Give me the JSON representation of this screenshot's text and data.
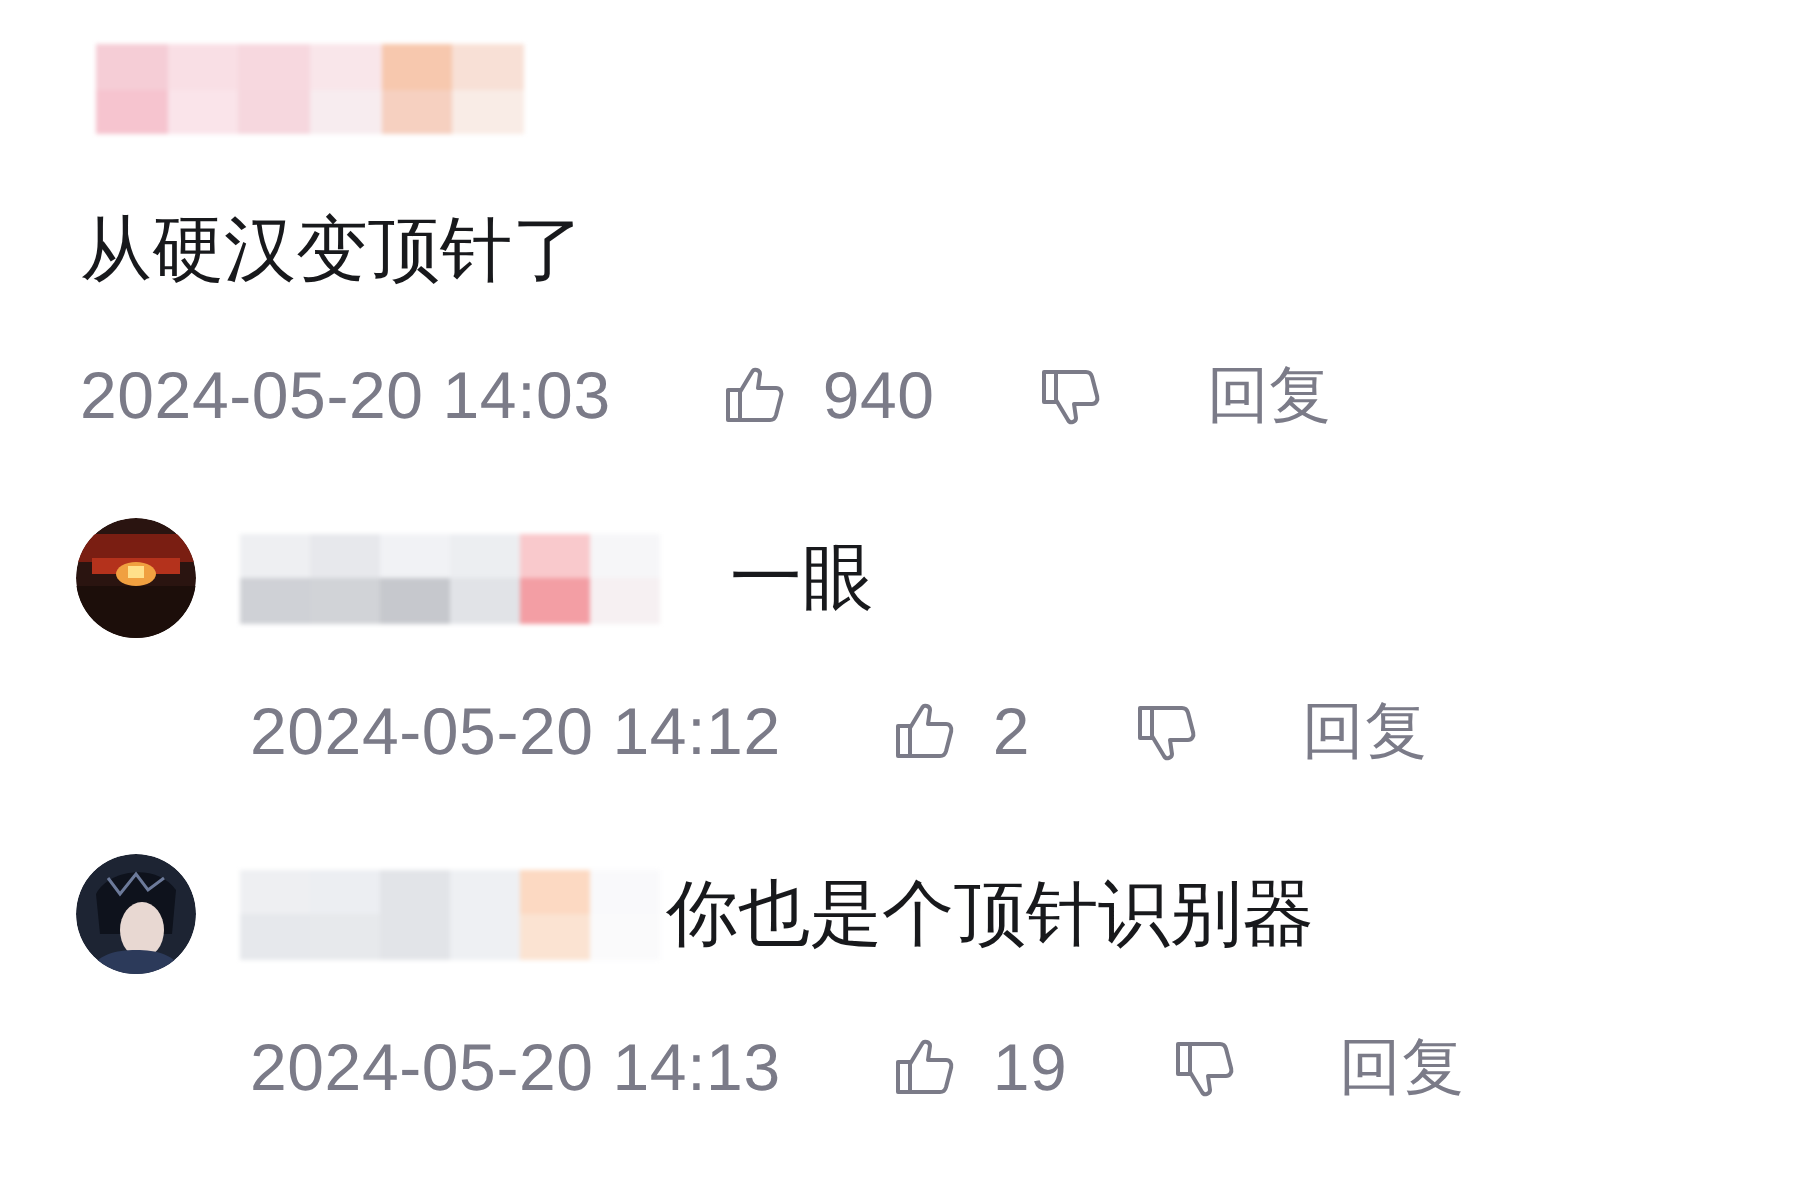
{
  "comments": [
    {
      "user": {
        "redacted": true
      },
      "text": "从硬汉变顶针了",
      "time": "2024-05-20 14:03",
      "likes": "940",
      "reply_label": "回复",
      "replies": [
        {
          "user": {
            "redacted": true
          },
          "text": "一眼",
          "time": "2024-05-20 14:12",
          "likes": "2",
          "reply_label": "回复"
        },
        {
          "user": {
            "redacted": true
          },
          "text": "你也是个顶针识别器",
          "time": "2024-05-20 14:13",
          "likes": "19",
          "reply_label": "回复"
        }
      ]
    }
  ]
}
